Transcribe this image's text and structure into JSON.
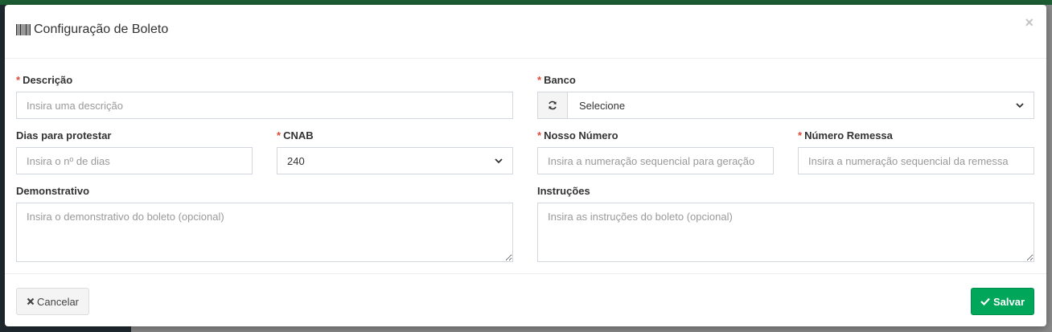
{
  "modal": {
    "title": "Configuração de Boleto",
    "close_label": "×"
  },
  "form": {
    "required_mark": "*",
    "descricao": {
      "label": "Descrição",
      "placeholder": "Insira uma descrição"
    },
    "banco": {
      "label": "Banco",
      "selected": "Selecione"
    },
    "dias_protestar": {
      "label": "Dias para protestar",
      "placeholder": "Insira o nº de dias"
    },
    "cnab": {
      "label": "CNAB",
      "selected": "240"
    },
    "nosso_numero": {
      "label": "Nosso Número",
      "placeholder": "Insira a numeração sequencial para geração"
    },
    "numero_remessa": {
      "label": "Número Remessa",
      "placeholder": "Insira a numeração sequencial da remessa"
    },
    "demonstrativo": {
      "label": "Demonstrativo",
      "placeholder": "Insira o demonstrativo do boleto (opcional)"
    },
    "instrucoes": {
      "label": "Instruções",
      "placeholder": "Insira as instruções do boleto (opcional)"
    }
  },
  "footer": {
    "cancel_label": "Cancelar",
    "save_label": "Salvar"
  },
  "colors": {
    "primary_success": "#00a65a",
    "required": "#dd4b39",
    "border": "#d2d6de"
  },
  "icons": {
    "title": "barcode-icon",
    "banco_addon": "refresh-icon",
    "cancel": "times-icon",
    "save": "check-icon"
  }
}
